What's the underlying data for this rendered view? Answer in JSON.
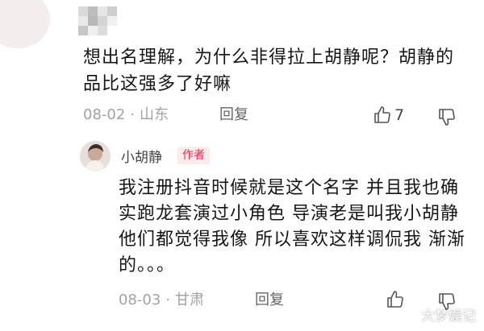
{
  "comment": {
    "text": "想出名理解，为什么非得拉上胡静呢？胡静的品比这强多了好嘛",
    "date": "08-02",
    "separator": "·",
    "location": "山东",
    "reply_label": "回复",
    "likes": "7",
    "icons": {
      "like": "thumbs-up-icon",
      "dislike": "thumbs-down-icon"
    }
  },
  "reply": {
    "username": "小胡静",
    "badge": "作者",
    "text": "我注册抖音时候就是这个名字 并且我也确实跑龙套演过小角色 导演老是叫我小胡静 他们都觉得我像 所以喜欢这样调侃我 渐渐的。。。",
    "date": "08-03",
    "separator": "·",
    "location": "甘肃",
    "reply_label": "回复",
    "icons": {
      "like": "thumbs-up-icon",
      "dislike": "thumbs-down-icon"
    }
  },
  "watermark": "大梦娱记",
  "colors": {
    "badge_text": "#f0284d",
    "badge_bg": "#fdebec",
    "meta_gray": "#a2a2a2"
  }
}
